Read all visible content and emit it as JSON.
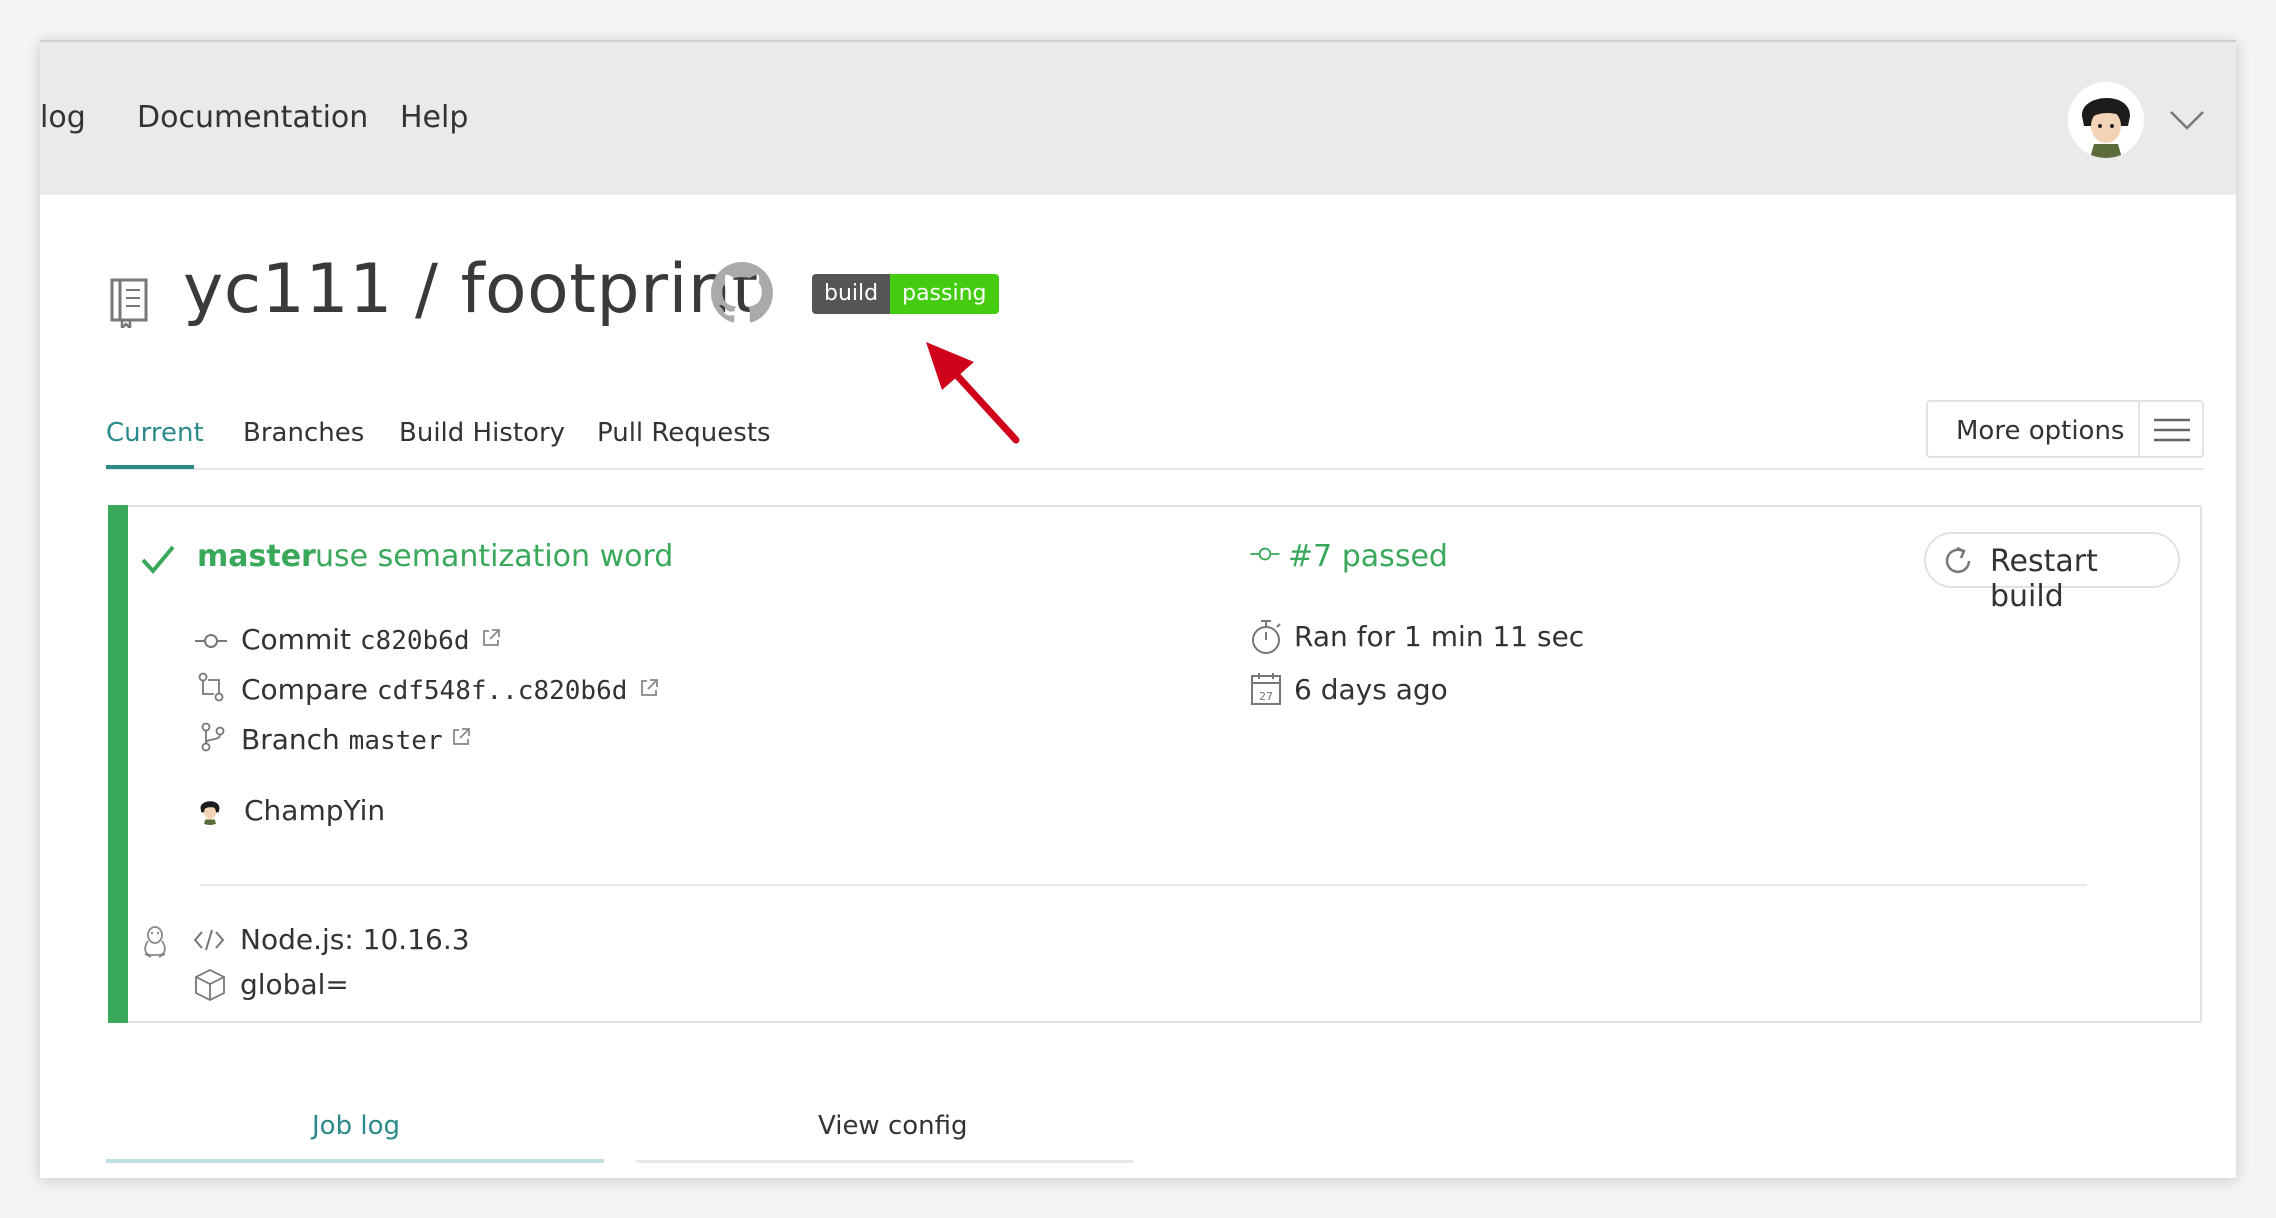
{
  "nav": {
    "links": [
      "log",
      "Documentation",
      "Help"
    ]
  },
  "repo": {
    "owner": "yc111",
    "separator": "/",
    "name": "footprint",
    "badge": {
      "left": "build",
      "right": "passing",
      "left_color": "#555555",
      "right_color": "#44cc11"
    }
  },
  "tabs": {
    "items": [
      "Current",
      "Branches",
      "Build History",
      "Pull Requests"
    ],
    "active": "Current",
    "more_options": "More options"
  },
  "build": {
    "status_color": "#39a85b",
    "branch": "master",
    "message": "use semantization word",
    "number_status": "#7 passed",
    "restart": "Restart build",
    "commit_label": "Commit",
    "commit_hash": "c820b6d",
    "compare_label": "Compare",
    "compare_range": "cdf548f..c820b6d",
    "branch_label": "Branch",
    "branch_value": "master",
    "author": "ChampYin",
    "duration": "Ran for 1 min 11 sec",
    "when": "6 days ago",
    "calendar_day": "27",
    "language": "Node.js: 10.16.3",
    "env": "global="
  },
  "bottom_tabs": {
    "job_log": "Job log",
    "view_config": "View config"
  },
  "colors": {
    "accent": "#2d8a8a",
    "passed": "#39a85b",
    "annotation_arrow": "#d0021b"
  }
}
